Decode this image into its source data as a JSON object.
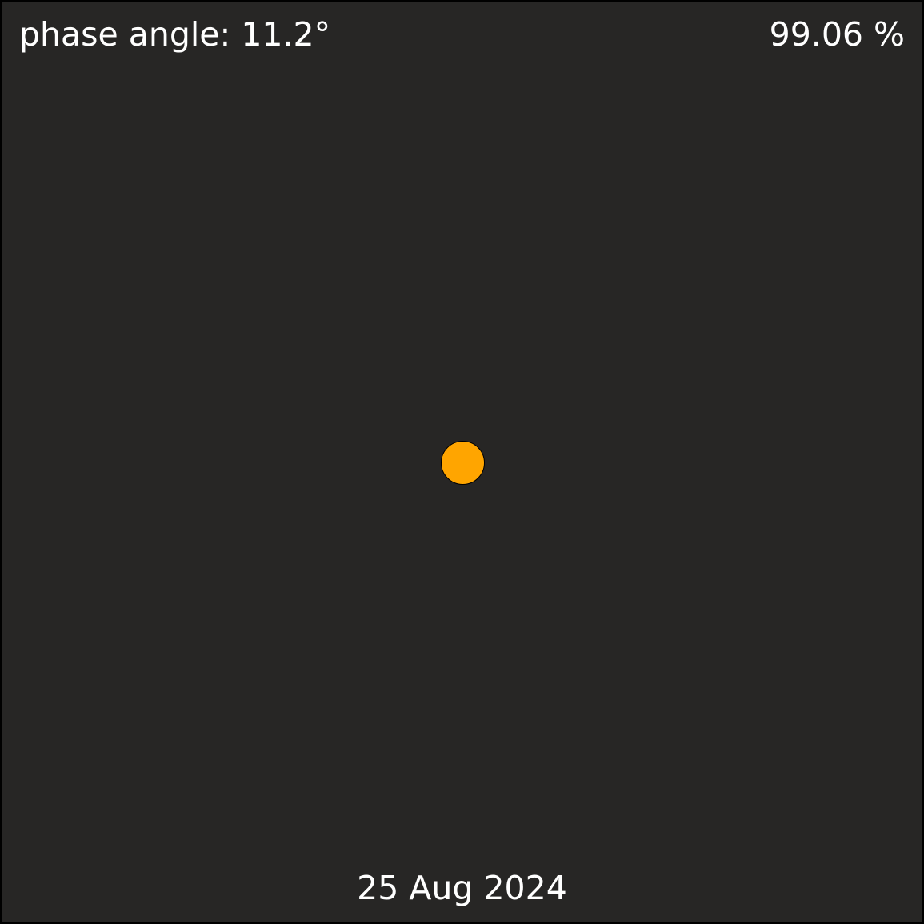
{
  "phase_angle_text": "phase angle: 11.2°",
  "illumination_text": "99.06 %",
  "date_text": "25 Aug 2024",
  "colors": {
    "background": "#272625",
    "disk": "#FFA500",
    "text": "#FFFFFF"
  }
}
